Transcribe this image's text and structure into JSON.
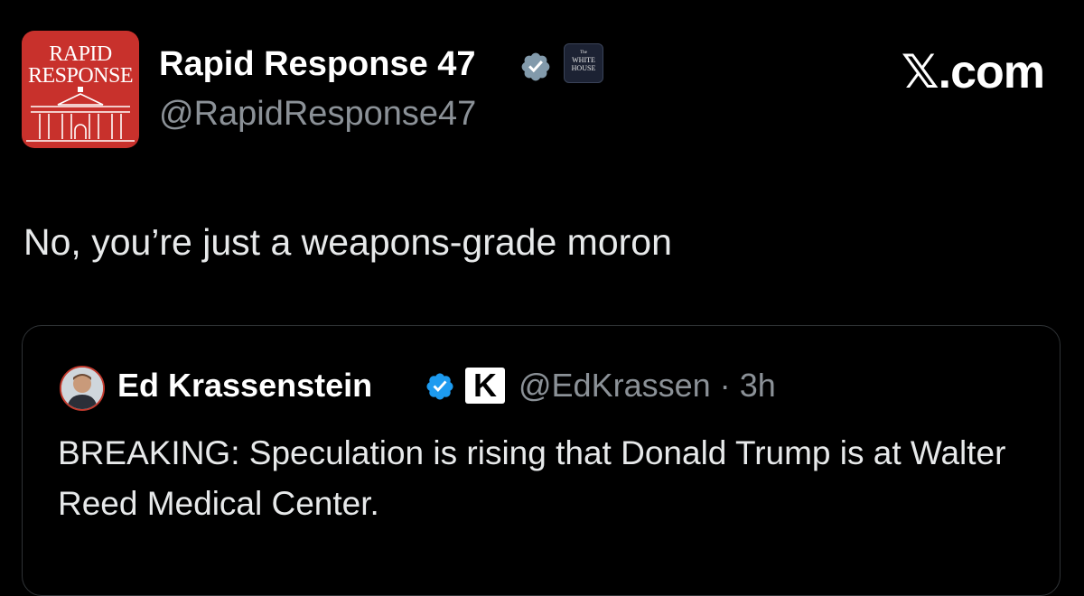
{
  "tweet": {
    "author": {
      "avatar_text_line1": "RAPID",
      "avatar_text_line2": "RESPONSE",
      "display_name": "Rapid Response 47",
      "handle": "@RapidResponse47",
      "verified_icon": "verified-badge-gray",
      "affiliate_badge": {
        "line1": "The",
        "line2": "WHITE",
        "line3": "HOUSE"
      }
    },
    "brand": "𝕏.com",
    "text": "No, you’re just a weapons-grade moron"
  },
  "quote": {
    "author": {
      "display_name": "Ed Krassenstein",
      "verified_icon": "verified-badge-blue",
      "affiliate_badge": "K",
      "handle": "@EdKrassen",
      "separator": "·",
      "time": "3h"
    },
    "text": "BREAKING: Speculation is rising that Donald Trump is at Walter Reed Medical Center."
  },
  "colors": {
    "background": "#000000",
    "text": "#e7e9ea",
    "muted": "#8b9197",
    "avatar_red": "#c8312c",
    "verified_blue": "#1d9bf0",
    "verified_gray": "#829aab"
  }
}
